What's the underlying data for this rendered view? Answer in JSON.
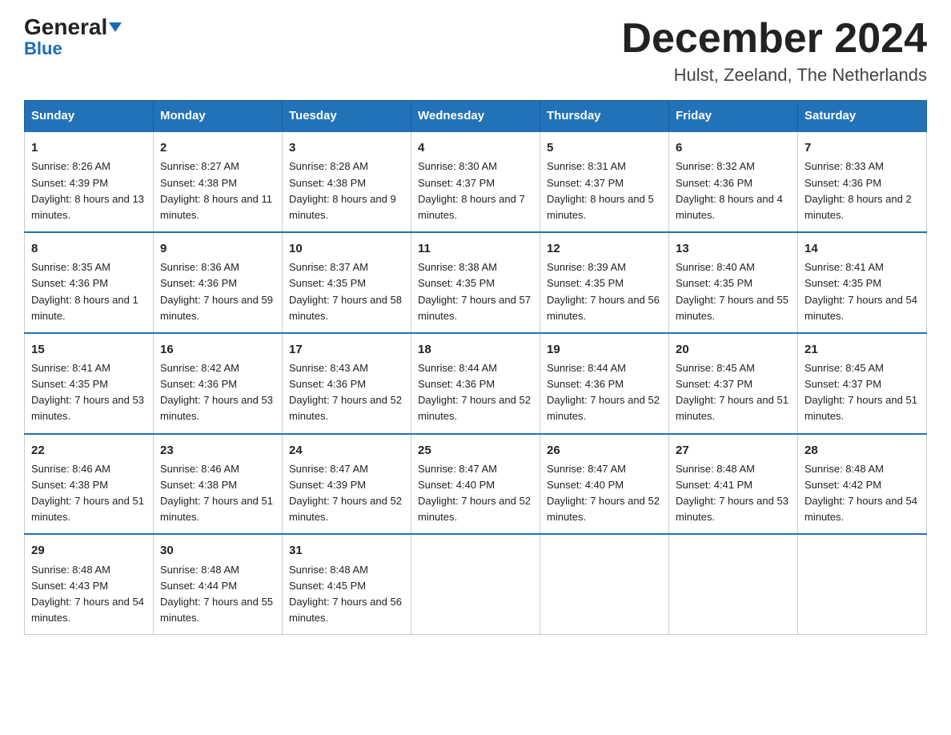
{
  "header": {
    "logo_general": "General",
    "logo_blue": "Blue",
    "month_title": "December 2024",
    "location": "Hulst, Zeeland, The Netherlands"
  },
  "days_of_week": [
    "Sunday",
    "Monday",
    "Tuesday",
    "Wednesday",
    "Thursday",
    "Friday",
    "Saturday"
  ],
  "weeks": [
    [
      {
        "day": "1",
        "sunrise": "8:26 AM",
        "sunset": "4:39 PM",
        "daylight": "8 hours and 13 minutes."
      },
      {
        "day": "2",
        "sunrise": "8:27 AM",
        "sunset": "4:38 PM",
        "daylight": "8 hours and 11 minutes."
      },
      {
        "day": "3",
        "sunrise": "8:28 AM",
        "sunset": "4:38 PM",
        "daylight": "8 hours and 9 minutes."
      },
      {
        "day": "4",
        "sunrise": "8:30 AM",
        "sunset": "4:37 PM",
        "daylight": "8 hours and 7 minutes."
      },
      {
        "day": "5",
        "sunrise": "8:31 AM",
        "sunset": "4:37 PM",
        "daylight": "8 hours and 5 minutes."
      },
      {
        "day": "6",
        "sunrise": "8:32 AM",
        "sunset": "4:36 PM",
        "daylight": "8 hours and 4 minutes."
      },
      {
        "day": "7",
        "sunrise": "8:33 AM",
        "sunset": "4:36 PM",
        "daylight": "8 hours and 2 minutes."
      }
    ],
    [
      {
        "day": "8",
        "sunrise": "8:35 AM",
        "sunset": "4:36 PM",
        "daylight": "8 hours and 1 minute."
      },
      {
        "day": "9",
        "sunrise": "8:36 AM",
        "sunset": "4:36 PM",
        "daylight": "7 hours and 59 minutes."
      },
      {
        "day": "10",
        "sunrise": "8:37 AM",
        "sunset": "4:35 PM",
        "daylight": "7 hours and 58 minutes."
      },
      {
        "day": "11",
        "sunrise": "8:38 AM",
        "sunset": "4:35 PM",
        "daylight": "7 hours and 57 minutes."
      },
      {
        "day": "12",
        "sunrise": "8:39 AM",
        "sunset": "4:35 PM",
        "daylight": "7 hours and 56 minutes."
      },
      {
        "day": "13",
        "sunrise": "8:40 AM",
        "sunset": "4:35 PM",
        "daylight": "7 hours and 55 minutes."
      },
      {
        "day": "14",
        "sunrise": "8:41 AM",
        "sunset": "4:35 PM",
        "daylight": "7 hours and 54 minutes."
      }
    ],
    [
      {
        "day": "15",
        "sunrise": "8:41 AM",
        "sunset": "4:35 PM",
        "daylight": "7 hours and 53 minutes."
      },
      {
        "day": "16",
        "sunrise": "8:42 AM",
        "sunset": "4:36 PM",
        "daylight": "7 hours and 53 minutes."
      },
      {
        "day": "17",
        "sunrise": "8:43 AM",
        "sunset": "4:36 PM",
        "daylight": "7 hours and 52 minutes."
      },
      {
        "day": "18",
        "sunrise": "8:44 AM",
        "sunset": "4:36 PM",
        "daylight": "7 hours and 52 minutes."
      },
      {
        "day": "19",
        "sunrise": "8:44 AM",
        "sunset": "4:36 PM",
        "daylight": "7 hours and 52 minutes."
      },
      {
        "day": "20",
        "sunrise": "8:45 AM",
        "sunset": "4:37 PM",
        "daylight": "7 hours and 51 minutes."
      },
      {
        "day": "21",
        "sunrise": "8:45 AM",
        "sunset": "4:37 PM",
        "daylight": "7 hours and 51 minutes."
      }
    ],
    [
      {
        "day": "22",
        "sunrise": "8:46 AM",
        "sunset": "4:38 PM",
        "daylight": "7 hours and 51 minutes."
      },
      {
        "day": "23",
        "sunrise": "8:46 AM",
        "sunset": "4:38 PM",
        "daylight": "7 hours and 51 minutes."
      },
      {
        "day": "24",
        "sunrise": "8:47 AM",
        "sunset": "4:39 PM",
        "daylight": "7 hours and 52 minutes."
      },
      {
        "day": "25",
        "sunrise": "8:47 AM",
        "sunset": "4:40 PM",
        "daylight": "7 hours and 52 minutes."
      },
      {
        "day": "26",
        "sunrise": "8:47 AM",
        "sunset": "4:40 PM",
        "daylight": "7 hours and 52 minutes."
      },
      {
        "day": "27",
        "sunrise": "8:48 AM",
        "sunset": "4:41 PM",
        "daylight": "7 hours and 53 minutes."
      },
      {
        "day": "28",
        "sunrise": "8:48 AM",
        "sunset": "4:42 PM",
        "daylight": "7 hours and 54 minutes."
      }
    ],
    [
      {
        "day": "29",
        "sunrise": "8:48 AM",
        "sunset": "4:43 PM",
        "daylight": "7 hours and 54 minutes."
      },
      {
        "day": "30",
        "sunrise": "8:48 AM",
        "sunset": "4:44 PM",
        "daylight": "7 hours and 55 minutes."
      },
      {
        "day": "31",
        "sunrise": "8:48 AM",
        "sunset": "4:45 PM",
        "daylight": "7 hours and 56 minutes."
      },
      null,
      null,
      null,
      null
    ]
  ]
}
